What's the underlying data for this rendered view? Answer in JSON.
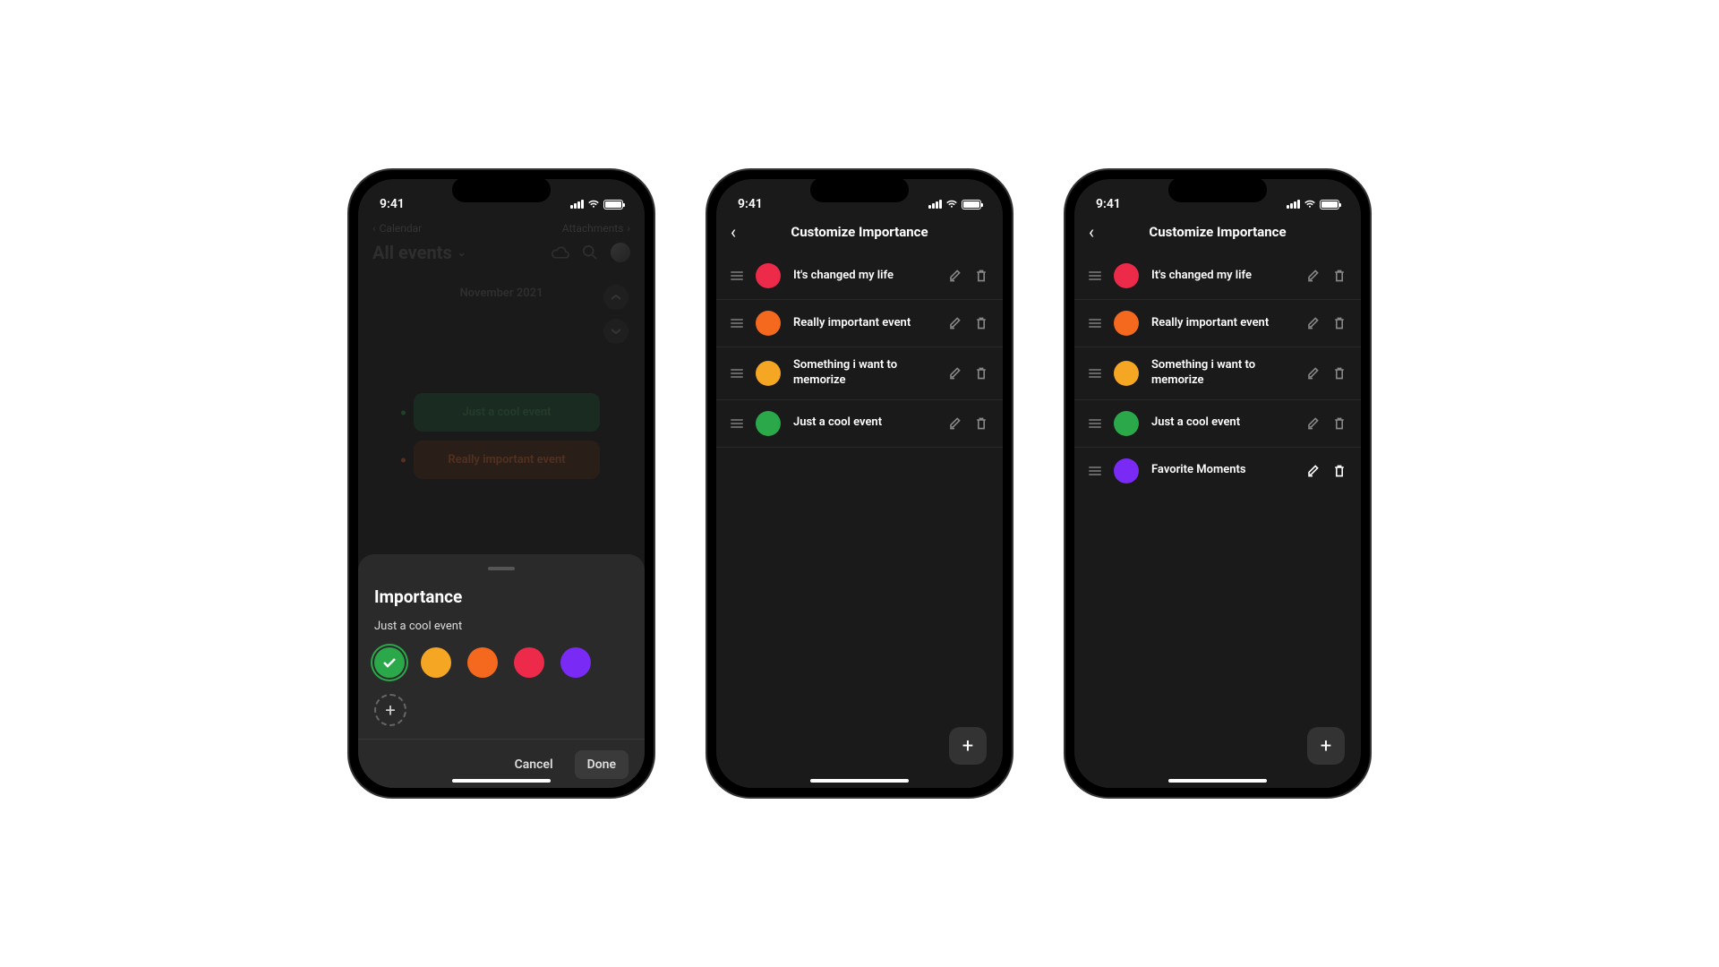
{
  "status": {
    "time": "9:41"
  },
  "screen1": {
    "nav_back": "Calendar",
    "nav_forward": "Attachments",
    "header_title": "All events",
    "month": "November 2021",
    "events": [
      {
        "label": "Just a cool event",
        "variant": "green"
      },
      {
        "label": "Really important event",
        "variant": "orange"
      }
    ],
    "sheet": {
      "title": "Importance",
      "subtitle": "Just a cool event",
      "colors": [
        {
          "hex": "#2aa84a",
          "selected": true
        },
        {
          "hex": "#f5a623",
          "selected": false
        },
        {
          "hex": "#f5691e",
          "selected": false
        },
        {
          "hex": "#ed2a4a",
          "selected": false
        },
        {
          "hex": "#7a2af5",
          "selected": false
        }
      ],
      "cancel": "Cancel",
      "done": "Done"
    }
  },
  "screen2": {
    "title": "Customize Importance",
    "items": [
      {
        "color": "#ed2a4a",
        "label": "It's changed my life"
      },
      {
        "color": "#f5691e",
        "label": "Really important event"
      },
      {
        "color": "#f5a623",
        "label": "Something i want to memorize"
      },
      {
        "color": "#2aa84a",
        "label": "Just a cool event"
      }
    ]
  },
  "screen3": {
    "title": "Customize Importance",
    "items": [
      {
        "color": "#ed2a4a",
        "label": "It's changed my life",
        "active": false
      },
      {
        "color": "#f5691e",
        "label": "Really important event",
        "active": false
      },
      {
        "color": "#f5a623",
        "label": "Something i want to memorize",
        "active": false
      },
      {
        "color": "#2aa84a",
        "label": "Just a cool event",
        "active": false
      },
      {
        "color": "#7a2af5",
        "label": "Favorite Moments",
        "active": true
      }
    ]
  }
}
